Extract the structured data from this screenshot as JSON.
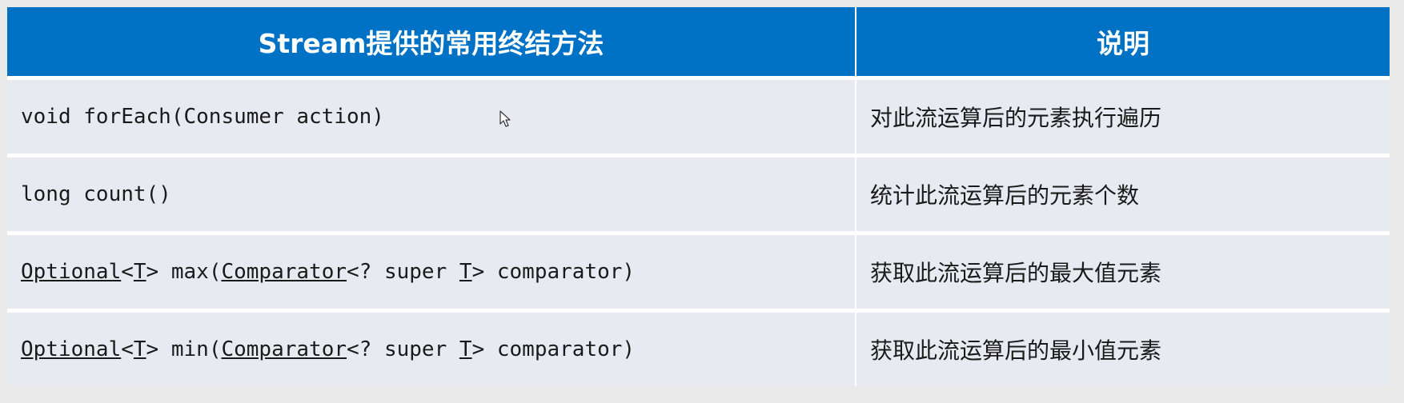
{
  "table": {
    "headers": [
      "Stream提供的常用终结方法",
      "说明"
    ],
    "rows": [
      {
        "method_parts": [
          {
            "text": "void forEach(Consumer action)",
            "u": false
          }
        ],
        "desc": "对此流运算后的元素执行遍历"
      },
      {
        "method_parts": [
          {
            "text": "long count()",
            "u": false
          }
        ],
        "desc": "统计此流运算后的元素个数"
      },
      {
        "method_parts": [
          {
            "text": "Optional",
            "u": true
          },
          {
            "text": "<",
            "u": false
          },
          {
            "text": "T",
            "u": true
          },
          {
            "text": "> max(",
            "u": false
          },
          {
            "text": "Comparator",
            "u": true
          },
          {
            "text": "<? super ",
            "u": false
          },
          {
            "text": "T",
            "u": true
          },
          {
            "text": "> comparator)",
            "u": false
          }
        ],
        "desc": "获取此流运算后的最大值元素"
      },
      {
        "method_parts": [
          {
            "text": "Optional",
            "u": true
          },
          {
            "text": "<",
            "u": false
          },
          {
            "text": "T",
            "u": true
          },
          {
            "text": "> min(",
            "u": false
          },
          {
            "text": "Comparator",
            "u": true
          },
          {
            "text": "<? super ",
            "u": false
          },
          {
            "text": "T",
            "u": true
          },
          {
            "text": "> comparator)",
            "u": false
          }
        ],
        "desc": "获取此流运算后的最小值元素"
      }
    ]
  },
  "colors": {
    "header_bg": "#0072c6",
    "row_bg": "#e7ebf1"
  },
  "icons": {
    "cursor": "mouse-pointer-icon"
  }
}
